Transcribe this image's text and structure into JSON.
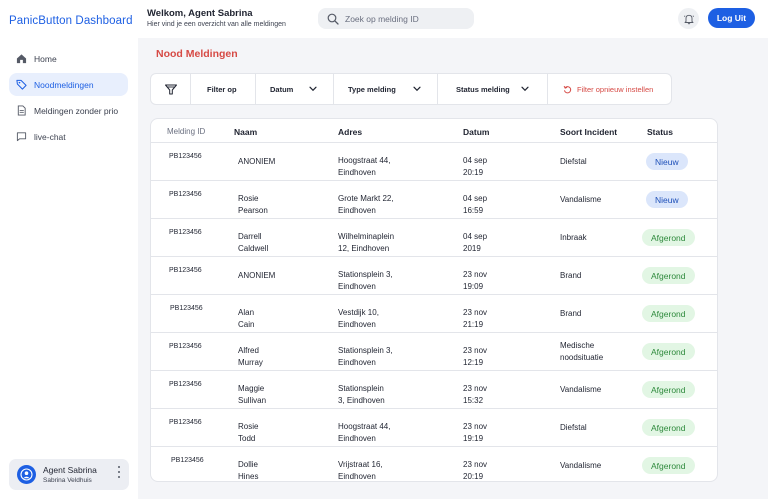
{
  "app": {
    "title": "PanicButton Dashboard"
  },
  "sidebar": {
    "items": [
      {
        "label": "Home",
        "icon": "home-icon",
        "active": false
      },
      {
        "label": "Noodmeldingen",
        "icon": "tag-icon",
        "active": true
      },
      {
        "label": "Meldingen zonder prio",
        "icon": "document-icon",
        "active": false
      },
      {
        "label": "live-chat",
        "icon": "chat-icon",
        "active": false
      }
    ],
    "user": {
      "name": "Agent Sabrina",
      "sub": "Sabrina Veldhuis"
    }
  },
  "header": {
    "welcome": "Welkom, Agent Sabrina",
    "subtitle": "Hier vind je een overzicht van alle meldingen",
    "search_placeholder": "Zoek op melding ID",
    "logout_label": "Log Uit"
  },
  "main": {
    "title": "Nood Meldingen",
    "filters": {
      "filter_label": "Filter op",
      "date_label": "Datum",
      "type_label": "Type melding",
      "status_label": "Status melding",
      "reset_label": "Filter opnieuw instellen"
    },
    "table": {
      "columns": [
        "Melding ID",
        "Naam",
        "Adres",
        "Datum",
        "Soort Incident",
        "Status"
      ],
      "rows": [
        {
          "id": "PB123456",
          "naam": [
            "ANONIEM",
            ""
          ],
          "adres": [
            "Hoogstraat 44,",
            "Eindhoven"
          ],
          "datum": [
            "04 sep",
            "20:19"
          ],
          "soort": [
            "Diefstal",
            ""
          ],
          "status": "Nieuw",
          "status_kind": "new"
        },
        {
          "id": "PB123456",
          "naam": [
            "Rosie",
            "Pearson"
          ],
          "adres": [
            "Grote Markt 22,",
            "Eindhoven"
          ],
          "datum": [
            "04 sep",
            "16:59"
          ],
          "soort": [
            "Vandalisme",
            ""
          ],
          "status": "Nieuw",
          "status_kind": "new"
        },
        {
          "id": "PB123456",
          "naam": [
            "Darrell",
            "Caldwell"
          ],
          "adres": [
            "Wilhelminaplein",
            "12, Eindhoven"
          ],
          "datum": [
            "04 sep",
            "2019"
          ],
          "soort": [
            "Inbraak",
            ""
          ],
          "status": "Afgerond",
          "status_kind": "done"
        },
        {
          "id": "PB123456",
          "naam": [
            "ANONIEM",
            ""
          ],
          "adres": [
            "Stationsplein 3,",
            "Eindhoven"
          ],
          "datum": [
            "23 nov",
            "19:09"
          ],
          "soort": [
            "Brand",
            ""
          ],
          "status": "Afgerond",
          "status_kind": "done"
        },
        {
          "id": "PB123456",
          "naam": [
            "Alan",
            "Cain"
          ],
          "adres": [
            "Vestdijk 10,",
            "Eindhoven"
          ],
          "datum": [
            "23 nov",
            "21:19"
          ],
          "soort": [
            "Brand",
            ""
          ],
          "status": "Afgerond",
          "status_kind": "done"
        },
        {
          "id": "PB123456",
          "naam": [
            "Alfred",
            "Murray"
          ],
          "adres": [
            "Stationsplein 3,",
            "Eindhoven"
          ],
          "datum": [
            "23 nov",
            "12:19"
          ],
          "soort": [
            "Medische",
            "noodsituatie"
          ],
          "status": "Afgerond",
          "status_kind": "done"
        },
        {
          "id": "PB123456",
          "naam": [
            "Maggie",
            "Sullivan"
          ],
          "adres": [
            "Stationsplein",
            "3, Eindhoven"
          ],
          "datum": [
            "23 nov",
            "15:32"
          ],
          "soort": [
            "Vandalisme",
            ""
          ],
          "status": "Afgerond",
          "status_kind": "done"
        },
        {
          "id": "PB123456",
          "naam": [
            "Rosie",
            "Todd"
          ],
          "adres": [
            "Hoogstraat 44,",
            "Eindhoven"
          ],
          "datum": [
            "23 nov",
            "19:19"
          ],
          "soort": [
            "Diefstal",
            ""
          ],
          "status": "Afgerond",
          "status_kind": "done"
        },
        {
          "id": "PB123456",
          "naam": [
            "Dollie",
            "Hines"
          ],
          "adres": [
            "Vrijstraat 16,",
            "Eindhoven"
          ],
          "datum": [
            "23 nov",
            "20:19"
          ],
          "soort": [
            "Vandalisme",
            ""
          ],
          "status": "Afgerond",
          "status_kind": "done"
        }
      ]
    }
  }
}
